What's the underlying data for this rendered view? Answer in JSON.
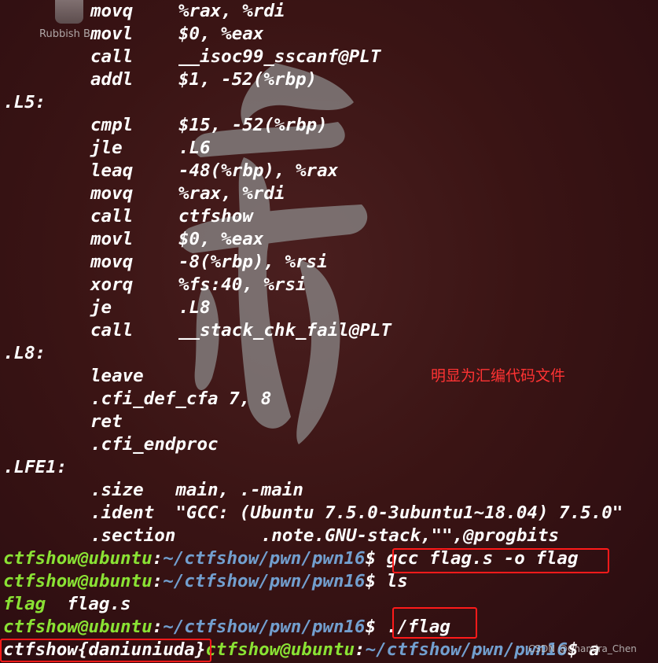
{
  "desktop": {
    "trash_label": "Rubbish B"
  },
  "watermark": {
    "text": ""
  },
  "code_lines": [
    {
      "ins": "movq",
      "arg": "%rax, %rdi"
    },
    {
      "ins": "movl",
      "arg": "$0, %eax"
    },
    {
      "ins": "call",
      "arg": "__isoc99_sscanf@PLT"
    },
    {
      "ins": "addl",
      "arg": "$1, -52(%rbp)"
    },
    {
      "label": ".L5:"
    },
    {
      "ins": "cmpl",
      "arg": "$15, -52(%rbp)"
    },
    {
      "ins": "jle",
      "arg": ".L6"
    },
    {
      "ins": "leaq",
      "arg": "-48(%rbp), %rax"
    },
    {
      "ins": "movq",
      "arg": "%rax, %rdi"
    },
    {
      "ins": "call",
      "arg": "ctfshow"
    },
    {
      "ins": "movl",
      "arg": "$0, %eax"
    },
    {
      "ins": "movq",
      "arg": "-8(%rbp), %rsi"
    },
    {
      "ins": "xorq",
      "arg": "%fs:40, %rsi"
    },
    {
      "ins": "je",
      "arg": ".L8"
    },
    {
      "ins": "call",
      "arg": "__stack_chk_fail@PLT"
    },
    {
      "label": ".L8:"
    },
    {
      "ins": "leave",
      "arg": ""
    },
    {
      "ins": ".cfi_def_cfa 7, 8",
      "arg": ""
    },
    {
      "ins": "ret",
      "arg": ""
    },
    {
      "ins": ".cfi_endproc",
      "arg": ""
    },
    {
      "label": ".LFE1:"
    },
    {
      "ins": ".size   main, .-main",
      "arg": ""
    },
    {
      "ins": ".ident  \"GCC: (Ubuntu 7.5.0-3ubuntu1~18.04) 7.5.0\"",
      "arg": ""
    },
    {
      "ins": ".section        .note.GNU-stack,\"\",@progbits",
      "arg": ""
    }
  ],
  "prompt": {
    "user_host": "ctfshow@ubuntu",
    "colon": ":",
    "path": "~/ctfshow/pwn/pwn16",
    "dollar": "$"
  },
  "commands": {
    "cmd1": "gcc flag.s -o flag",
    "cmd2": "ls",
    "ls_out_1": "flag",
    "ls_out_2": "flag.s",
    "cmd3": "./flag",
    "flag_output": "ctfshow{daniuniuda}",
    "last_partial": "a"
  },
  "annotation": {
    "note": "明显为汇编代码文件"
  },
  "credit": {
    "text": "CSDN @Chandra_Chen"
  },
  "colors": {
    "user_host": "#8ae234",
    "path": "#729fcf",
    "highlight_box": "#ff1a1a",
    "note": "#ff3333"
  }
}
